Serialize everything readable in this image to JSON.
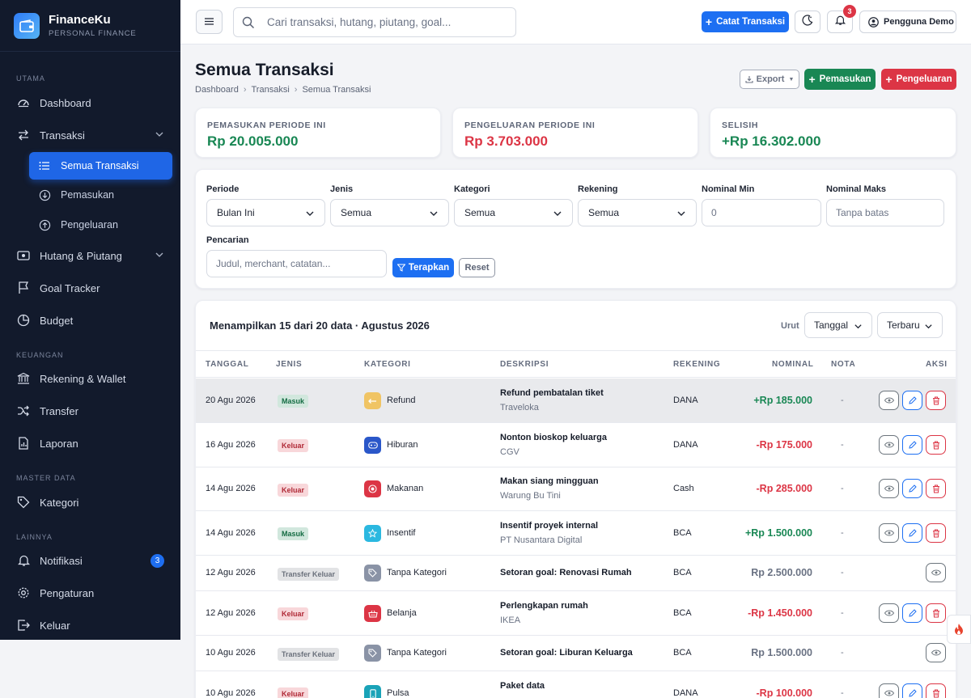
{
  "brand": {
    "name": "FinanceKu",
    "subtitle": "PERSONAL FINANCE"
  },
  "sidebar": {
    "sections": {
      "utama": "UTAMA",
      "keuangan": "KEUANGAN",
      "master": "MASTER DATA",
      "lainnya": "LAINNYA"
    },
    "dashboard": "Dashboard",
    "transaksi": "Transaksi",
    "semua_transaksi": "Semua Transaksi",
    "pemasukan": "Pemasukan",
    "pengeluaran": "Pengeluaran",
    "hutang": "Hutang & Piutang",
    "goal": "Goal Tracker",
    "budget": "Budget",
    "rekening": "Rekening & Wallet",
    "transfer": "Transfer",
    "laporan": "Laporan",
    "kategori": "Kategori",
    "notifikasi": "Notifikasi",
    "notifikasi_count": "3",
    "pengaturan": "Pengaturan",
    "keluar": "Keluar"
  },
  "topbar": {
    "search_placeholder": "Cari transaksi, hutang, piutang, goal...",
    "catat_label": "Catat Transaksi",
    "notif_count": "3",
    "user_name": "Pengguna Demo"
  },
  "page": {
    "title": "Semua Transaksi",
    "breadcrumb": [
      "Dashboard",
      "Transaksi",
      "Semua Transaksi"
    ],
    "export_label": "Export",
    "pemasukan_label": "Pemasukan",
    "pengeluaran_label": "Pengeluaran"
  },
  "summary": {
    "pemasukan_label": "PEMASUKAN PERIODE INI",
    "pemasukan_value": "Rp 20.005.000",
    "pengeluaran_label": "PENGELUARAN PERIODE INI",
    "pengeluaran_value": "Rp 3.703.000",
    "selisih_label": "SELISIH",
    "selisih_value": "+Rp 16.302.000",
    "colors": {
      "positive": "#198754",
      "negative": "#dc3545"
    }
  },
  "filters": {
    "periode_label": "Periode",
    "periode_value": "Bulan Ini",
    "jenis_label": "Jenis",
    "jenis_value": "Semua",
    "kategori_label": "Kategori",
    "kategori_value": "Semua",
    "rekening_label": "Rekening",
    "rekening_value": "Semua",
    "nominal_min_label": "Nominal Min",
    "nominal_min_value": "0",
    "nominal_maks_label": "Nominal Maks",
    "nominal_maks_placeholder": "Tanpa batas",
    "pencarian_label": "Pencarian",
    "pencarian_placeholder": "Judul, merchant, catatan...",
    "terapkan_label": "Terapkan",
    "reset_label": "Reset"
  },
  "table": {
    "summary": "Menampilkan 15 dari 20 data · Agustus 2026",
    "sort_label": "Urut",
    "sort_field": "Tanggal",
    "sort_order": "Terbaru",
    "headers": [
      "TANGGAL",
      "JENIS",
      "KATEGORI",
      "DESKRIPSI",
      "REKENING",
      "NOMINAL",
      "NOTA",
      "AKSI"
    ],
    "rows": [
      {
        "date": "20 Agu 2026",
        "type": "Masuk",
        "category": "Refund",
        "cat_color": "#f0c464",
        "title": "Refund pembatalan tiket",
        "sub": "Traveloka",
        "account": "DANA",
        "amount": "+Rp 185.000",
        "nota": "-"
      },
      {
        "date": "16 Agu 2026",
        "type": "Keluar",
        "category": "Hiburan",
        "cat_color": "#2a57c9",
        "title": "Nonton bioskop keluarga",
        "sub": "CGV",
        "account": "DANA",
        "amount": "-Rp 175.000",
        "nota": "-"
      },
      {
        "date": "14 Agu 2026",
        "type": "Keluar",
        "category": "Makanan",
        "cat_color": "#dc3545",
        "title": "Makan siang mingguan",
        "sub": "Warung Bu Tini",
        "account": "Cash",
        "amount": "-Rp 285.000",
        "nota": "-"
      },
      {
        "date": "14 Agu 2026",
        "type": "Masuk",
        "category": "Insentif",
        "cat_color": "#2bb8e0",
        "title": "Insentif proyek internal",
        "sub": "PT Nusantara Digital",
        "account": "BCA",
        "amount": "+Rp 1.500.000",
        "nota": "-"
      },
      {
        "date": "12 Agu 2026",
        "type": "Transfer Keluar",
        "category": "Tanpa Kategori",
        "cat_color": "#8a93a6",
        "title": "Setoran goal: Renovasi Rumah",
        "sub": "",
        "account": "BCA",
        "amount": "Rp 2.500.000",
        "nota": "-"
      },
      {
        "date": "12 Agu 2026",
        "type": "Keluar",
        "category": "Belanja",
        "cat_color": "#dc3545",
        "title": "Perlengkapan rumah",
        "sub": "IKEA",
        "account": "BCA",
        "amount": "-Rp 1.450.000",
        "nota": "-"
      },
      {
        "date": "10 Agu 2026",
        "type": "Transfer Keluar",
        "category": "Tanpa Kategori",
        "cat_color": "#8a93a6",
        "title": "Setoran goal: Liburan Keluarga",
        "sub": "",
        "account": "BCA",
        "amount": "Rp 1.500.000",
        "nota": "-"
      },
      {
        "date": "10 Agu 2026",
        "type": "Keluar",
        "category": "Pulsa",
        "cat_color": "#1aa3b8",
        "title": "Paket data",
        "sub": "",
        "account": "DANA",
        "amount": "-Rp 100.000",
        "nota": "-"
      }
    ]
  }
}
